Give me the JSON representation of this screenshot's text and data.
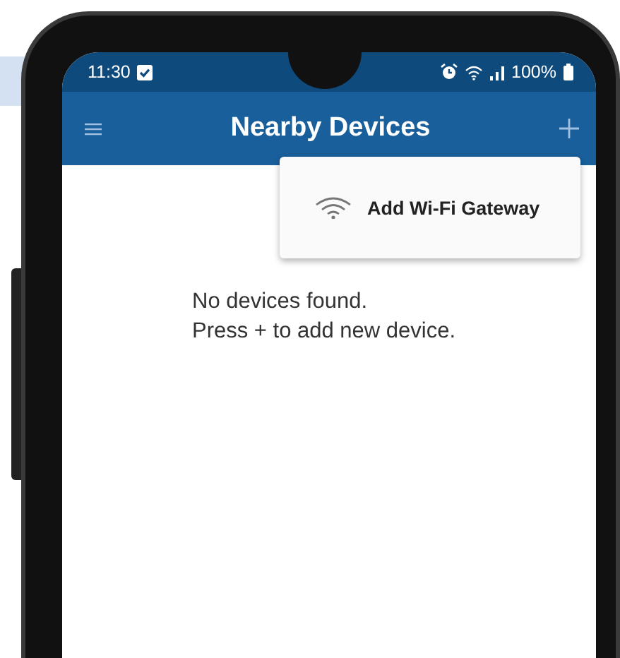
{
  "status_bar": {
    "time": "11:30",
    "battery": "100%"
  },
  "app_bar": {
    "title": "Nearby Devices"
  },
  "menu": {
    "items": [
      {
        "label": "Add Wi-Fi Gateway"
      }
    ]
  },
  "empty_message": [
    "No devices found.",
    "Press + to add new device."
  ]
}
